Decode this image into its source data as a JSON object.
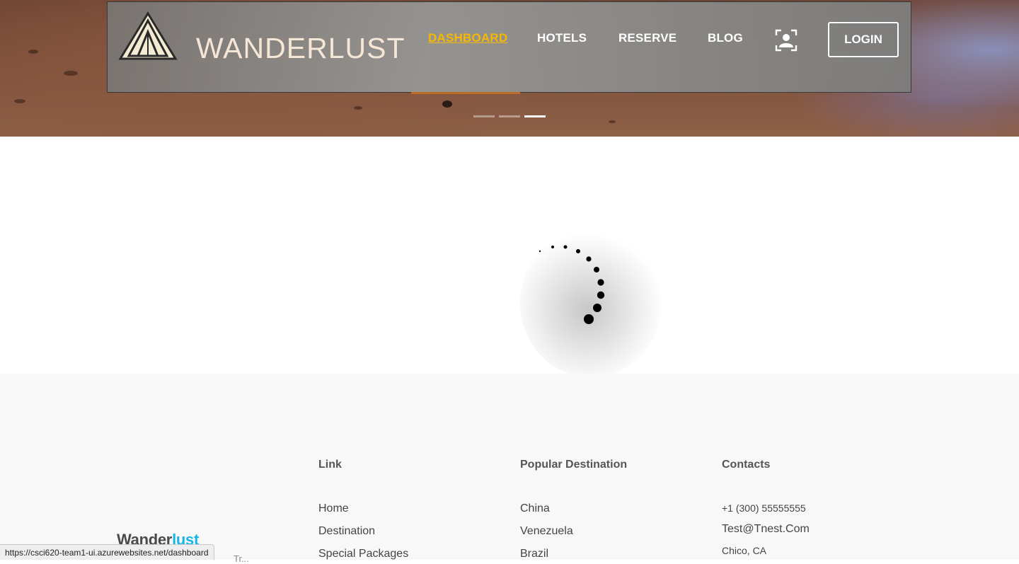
{
  "header": {
    "brand": "WANDERLUST",
    "nav": [
      {
        "label": "DASHBOARD",
        "active": true
      },
      {
        "label": "HOTELS",
        "active": false
      },
      {
        "label": "RESERVE",
        "active": false
      },
      {
        "label": "BLOG",
        "active": false
      }
    ],
    "profile_icon": "user-profile-icon",
    "login_label": "LOGIN",
    "slider": {
      "count": 3,
      "active_index": 2
    }
  },
  "loader": {
    "icon": "spinner-dots-icon",
    "state": "loading"
  },
  "footer": {
    "brand_part1": "Wander",
    "brand_part2": "lust",
    "tagline": "Tr...",
    "columns": [
      {
        "title": "Link",
        "items": [
          "Home",
          "Destination",
          "Special Packages"
        ]
      },
      {
        "title": "Popular Destination",
        "items": [
          "China",
          "Venezuela",
          "Brazil"
        ]
      },
      {
        "title": "Contacts",
        "items": [
          "+1 (300) 55555555",
          "Test@Tnest.Com",
          "Chico, CA"
        ]
      }
    ]
  },
  "status_bar": {
    "url": "https://csci620-team1-ui.azurewebsites.net/dashboard"
  },
  "colors": {
    "active_nav": "#f6b800",
    "brand_accent": "#18b6e6",
    "footer_bg": "#f8f8f8"
  }
}
